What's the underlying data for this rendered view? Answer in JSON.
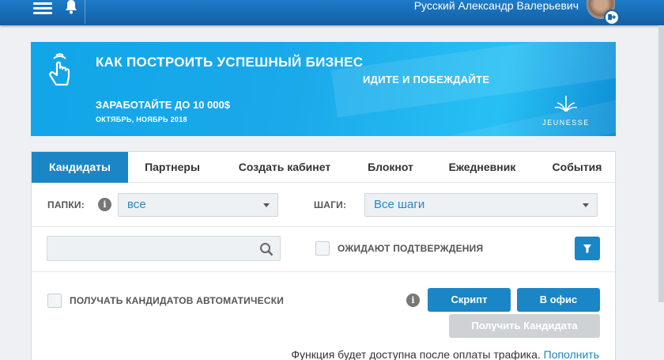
{
  "header": {
    "user_name": "Русский Александр Валерьевич"
  },
  "banner": {
    "title": "КАК ПОСТРОИТЬ УСПЕШНЫЙ БИЗНЕС",
    "subtitle": "ИДИТЕ И ПОБЕЖДАЙТЕ",
    "earn": "ЗАРАБОТАЙТЕ ДО 10 000$",
    "dates": "ОКТЯБРЬ, НОЯБРЬ 2018",
    "brand": "JEUNESSE"
  },
  "tabs": [
    {
      "label": "Кандидаты",
      "active": true
    },
    {
      "label": "Партнеры"
    },
    {
      "label": "Создать кабинет"
    },
    {
      "label": "Блокнот"
    },
    {
      "label": "Ежедневник"
    },
    {
      "label": "События"
    }
  ],
  "filters": {
    "folders_label": "ПАПКИ:",
    "folders_value": "все",
    "steps_label": "ШАГИ:",
    "steps_value": "Все шаги"
  },
  "search": {
    "value": "",
    "placeholder": ""
  },
  "pending": {
    "label": "ОЖИДАЮТ ПОДТВЕРЖДЕНИЯ"
  },
  "auto": {
    "label": "ПОЛУЧАТЬ КАНДИДАТОВ АВТОМАТИЧЕСКИ"
  },
  "buttons": {
    "script": "Скрипт",
    "office": "В офис",
    "get_candidate": "Получить Кандидата"
  },
  "note": {
    "text": "Функция будет доступна после оплаты трафика.",
    "link": "Пополнить"
  },
  "colors": {
    "accent": "#1a86c5",
    "header": "#1565a9"
  }
}
